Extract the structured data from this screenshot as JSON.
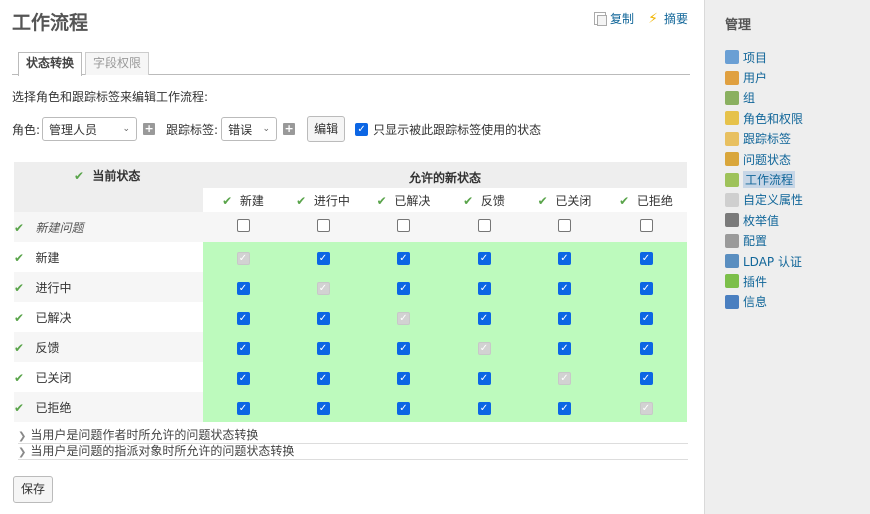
{
  "header": {
    "title": "工作流程"
  },
  "contextual": {
    "copy_label": "复制",
    "summary_label": "摘要"
  },
  "tabs": [
    {
      "label": "状态转换",
      "selected": true
    },
    {
      "label": "字段权限",
      "selected": false
    }
  ],
  "instruction": "选择角色和跟踪标签来编辑工作流程:",
  "filters": {
    "role_label": "角色:",
    "role_value": "管理人员",
    "tracker_label": "跟踪标签:",
    "tracker_value": "错误",
    "edit_button": "编辑",
    "only_used_label": "只显示被此跟踪标签使用的状态",
    "only_used_checked": true
  },
  "table": {
    "current_header": "当前状态",
    "allowed_header": "允许的新状态",
    "columns": [
      "新建",
      "进行中",
      "已解决",
      "反馈",
      "已关闭",
      "已拒绝"
    ],
    "rows": [
      {
        "label": "新建问题",
        "cells": [
          "off",
          "off",
          "off",
          "off",
          "off",
          "off"
        ]
      },
      {
        "label": "新建",
        "cells": [
          "dis",
          "on",
          "on",
          "on",
          "on",
          "on"
        ]
      },
      {
        "label": "进行中",
        "cells": [
          "on",
          "dis",
          "on",
          "on",
          "on",
          "on"
        ]
      },
      {
        "label": "已解决",
        "cells": [
          "on",
          "on",
          "dis",
          "on",
          "on",
          "on"
        ]
      },
      {
        "label": "反馈",
        "cells": [
          "on",
          "on",
          "on",
          "dis",
          "on",
          "on"
        ]
      },
      {
        "label": "已关闭",
        "cells": [
          "on",
          "on",
          "on",
          "on",
          "dis",
          "on"
        ]
      },
      {
        "label": "已拒绝",
        "cells": [
          "on",
          "on",
          "on",
          "on",
          "on",
          "dis"
        ]
      }
    ]
  },
  "collapsibles": [
    "当用户是问题作者时所允许的问题状态转换",
    "当用户是问题的指派对象时所允许的问题状态转换"
  ],
  "save_button": "保存",
  "sidebar": {
    "title": "管理",
    "items": [
      {
        "label": "项目",
        "icon": "projects-icon",
        "color": "#6a9fd4"
      },
      {
        "label": "用户",
        "icon": "user-icon",
        "color": "#e0a040"
      },
      {
        "label": "组",
        "icon": "group-icon",
        "color": "#8ab060"
      },
      {
        "label": "角色和权限",
        "icon": "roles-icon",
        "color": "#e6c24a"
      },
      {
        "label": "跟踪标签",
        "icon": "trackers-icon",
        "color": "#e8c060"
      },
      {
        "label": "问题状态",
        "icon": "issue-status-icon",
        "color": "#d9a63b"
      },
      {
        "label": "工作流程",
        "icon": "workflow-icon",
        "color": "#9ec25a",
        "selected": true
      },
      {
        "label": "自定义属性",
        "icon": "custom-fields-icon",
        "color": "#cfcfcf"
      },
      {
        "label": "枚举值",
        "icon": "enumerations-icon",
        "color": "#7a7a7a"
      },
      {
        "label": "配置",
        "icon": "settings-icon",
        "color": "#9a9a9a"
      },
      {
        "label": "LDAP 认证",
        "icon": "ldap-icon",
        "color": "#5a8ec0"
      },
      {
        "label": "插件",
        "icon": "plugins-icon",
        "color": "#7cbf4a"
      },
      {
        "label": "信息",
        "icon": "info-icon",
        "color": "#4a7fc0"
      }
    ]
  }
}
